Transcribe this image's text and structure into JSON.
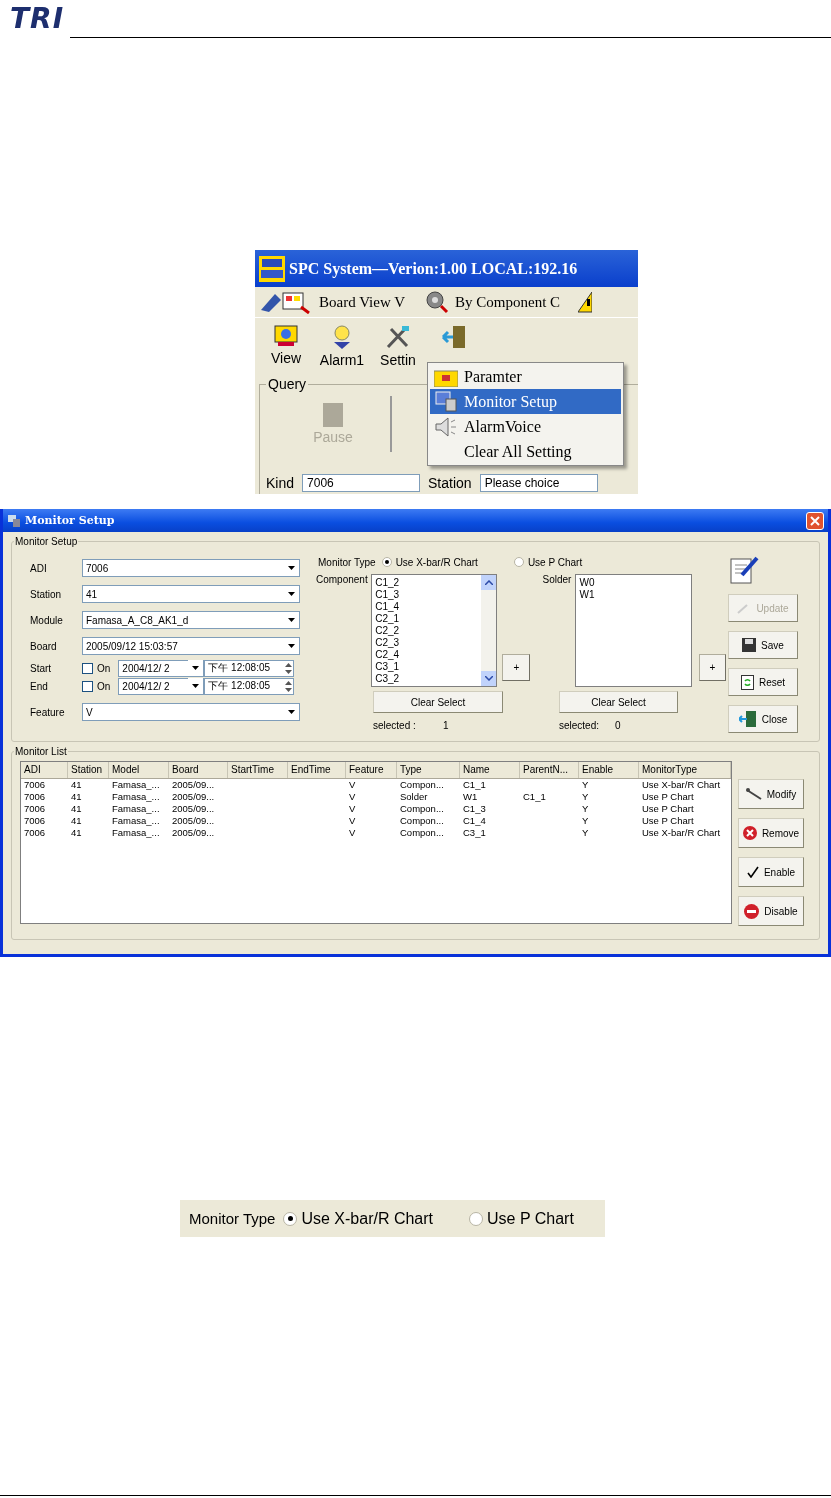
{
  "header": {
    "logo": "TRI"
  },
  "main_window": {
    "title": "SPC System—Verion:1.00 LOCAL:192.16",
    "menu": [
      {
        "label": "Board View V"
      },
      {
        "label": "By Component C"
      }
    ],
    "toolbar": [
      {
        "label": "View"
      },
      {
        "label": "Alarm1"
      },
      {
        "label": "Settin"
      }
    ],
    "query": {
      "title": "Query",
      "pause_button": "Pause",
      "kind_label": "Kind",
      "kind_value": "7006",
      "station_label": "Station",
      "station_value": "Please choice"
    },
    "context_menu": [
      {
        "label": "Paramter",
        "selected": false
      },
      {
        "label": "Monitor Setup",
        "selected": true
      },
      {
        "label": "AlarmVoice",
        "selected": false
      },
      {
        "label": "Clear All Setting",
        "selected": false
      }
    ]
  },
  "monitor_setup": {
    "title": "Monitor Setup",
    "group_title": "Monitor Setup",
    "fields": [
      {
        "label": "ADI",
        "value": "7006"
      },
      {
        "label": "Station",
        "value": "41"
      },
      {
        "label": "Module",
        "value": "Famasa_A_C8_AK1_d"
      },
      {
        "label": "Board",
        "value": "2005/09/12 15:03:57"
      }
    ],
    "range": [
      {
        "label": "Start",
        "on_label": "On",
        "checked": false,
        "date": "2004/12/ 2",
        "time": "下午 12:08:05"
      },
      {
        "label": "End",
        "on_label": "On",
        "checked": false,
        "date": "2004/12/ 2",
        "time": "下午 12:08:05"
      }
    ],
    "feature": {
      "label": "Feature",
      "value": "V"
    },
    "monitor_type": {
      "label": "Monitor Type",
      "options": [
        {
          "label": "Use X-bar/R Chart",
          "selected": true
        },
        {
          "label": "Use P Chart",
          "selected": false
        }
      ]
    },
    "component": {
      "label": "Component",
      "items": [
        "C1_2",
        "C1_3",
        "C1_4",
        "C2_1",
        "C2_2",
        "C2_3",
        "C2_4",
        "C3_1",
        "C3_2"
      ],
      "add_button": "+",
      "clear_button": "Clear Select",
      "selected_label": "selected :",
      "selected_count": "1"
    },
    "solder": {
      "label": "Solder",
      "items": [
        "W0",
        "W1"
      ],
      "add_button": "+",
      "clear_button": "Clear Select",
      "selected_label": "selected:",
      "selected_count": "0"
    },
    "actions": [
      {
        "label": "Update",
        "disabled": true
      },
      {
        "label": "Save",
        "disabled": false
      },
      {
        "label": "Reset",
        "disabled": false
      },
      {
        "label": "Close",
        "disabled": false
      }
    ],
    "list": {
      "title": "Monitor List",
      "columns": [
        "ADI",
        "Station",
        "Model",
        "Board",
        "StartTime",
        "EndTime",
        "Feature",
        "Type",
        "Name",
        "ParentN...",
        "Enable",
        "MonitorType"
      ],
      "rows": [
        [
          "7006",
          "41",
          "Famasa_...",
          "2005/09...",
          "",
          "",
          "V",
          "Compon...",
          "C1_1",
          "",
          "Y",
          "Use X-bar/R Chart"
        ],
        [
          "7006",
          "41",
          "Famasa_...",
          "2005/09...",
          "",
          "",
          "V",
          "Solder",
          "W1",
          "C1_1",
          "Y",
          "Use P Chart"
        ],
        [
          "7006",
          "41",
          "Famasa_...",
          "2005/09...",
          "",
          "",
          "V",
          "Compon...",
          "C1_3",
          "",
          "Y",
          "Use P Chart"
        ],
        [
          "7006",
          "41",
          "Famasa_...",
          "2005/09...",
          "",
          "",
          "V",
          "Compon...",
          "C1_4",
          "",
          "Y",
          "Use P Chart"
        ],
        [
          "7006",
          "41",
          "Famasa_...",
          "2005/09...",
          "",
          "",
          "V",
          "Compon...",
          "C3_1",
          "",
          "Y",
          "Use X-bar/R Chart"
        ]
      ]
    },
    "list_actions": [
      {
        "label": "Modify"
      },
      {
        "label": "Remove"
      },
      {
        "label": "Enable"
      },
      {
        "label": "Disable"
      }
    ]
  },
  "type_excerpt": {
    "label": "Monitor Type",
    "options": [
      {
        "label": "Use X-bar/R Chart",
        "selected": true
      },
      {
        "label": "Use P Chart",
        "selected": false
      }
    ]
  }
}
